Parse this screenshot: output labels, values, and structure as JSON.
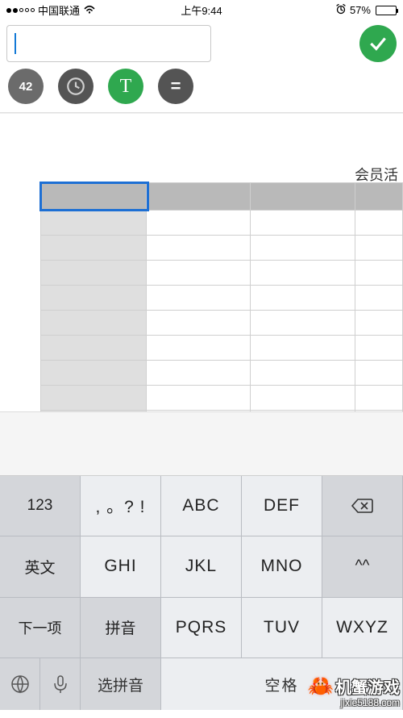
{
  "status": {
    "carrier": "中国联通",
    "time": "上午9:44",
    "battery_pct": "57%"
  },
  "editor": {
    "input_value": "",
    "input_placeholder": ""
  },
  "toolbar": {
    "icon_42_label": "42"
  },
  "sheet": {
    "floating_label": "会员活",
    "rows": 9,
    "cols": 4
  },
  "keyboard": {
    "rows": [
      [
        "123",
        ", 。? !",
        "ABC",
        "DEF"
      ],
      [
        "英文",
        "GHI",
        "JKL",
        "MNO",
        "^^"
      ],
      [
        "拼音",
        "PQRS",
        "TUV",
        "WXYZ"
      ]
    ],
    "backspace": "⌫",
    "next_label": "下一项",
    "bottom": {
      "select_pinyin": "选拼音",
      "space": "空格"
    }
  },
  "watermark": {
    "brand": "机蟹游戏",
    "url": "jixie5188.com"
  }
}
